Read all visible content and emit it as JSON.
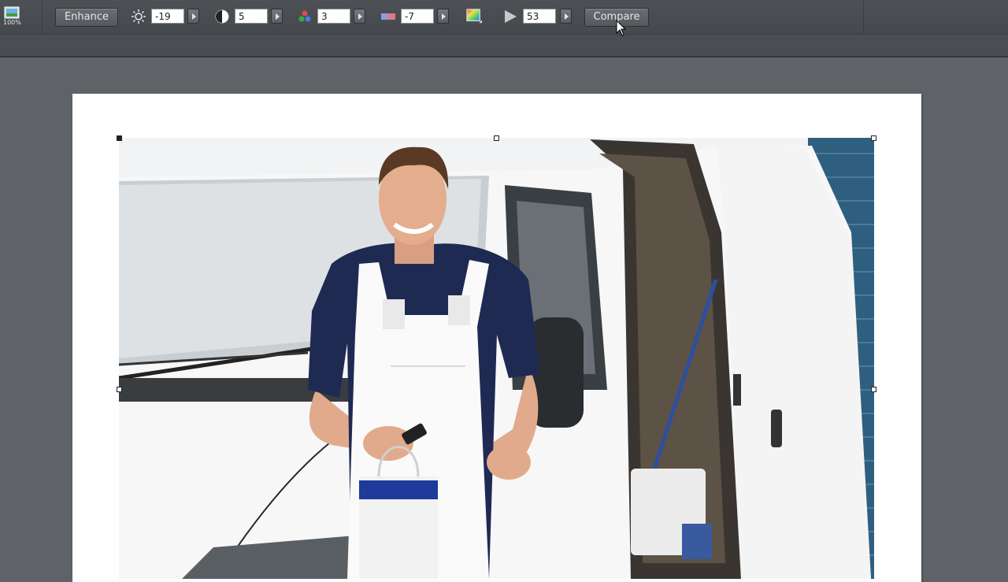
{
  "toolbar": {
    "zoom_label": "100%",
    "enhance_label": "Enhance",
    "compare_label": "Compare",
    "brightness": "-19",
    "contrast": "5",
    "saturation": "3",
    "temperature": "-7",
    "sharpen": "53"
  },
  "icons": {
    "zoom": "image-zoom-icon",
    "brightness": "sun-icon",
    "contrast": "contrast-icon",
    "saturation": "color-dots-icon",
    "temperature": "temperature-icon",
    "tint": "color-square-icon",
    "sharpen": "triangle-icon"
  },
  "colors": {
    "toolbar_bg": "#4a4e52",
    "workspace_bg": "#5f6367",
    "page_bg": "#ffffff"
  }
}
